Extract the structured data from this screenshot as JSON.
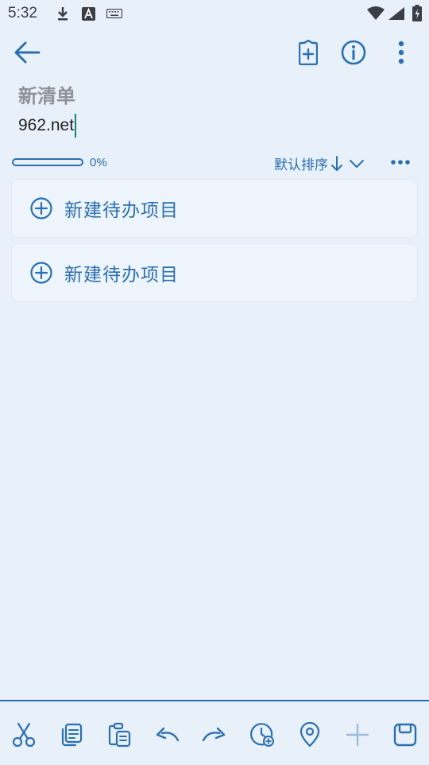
{
  "status_bar": {
    "time": "5:32"
  },
  "header": {
    "back_icon": "arrow-left-icon",
    "add_tag_icon": "tag-add-icon",
    "info_icon": "info-icon",
    "more_icon": "more-vertical-icon"
  },
  "list": {
    "title": "新清单",
    "title_input_value": "962.net",
    "progress_percent": 0,
    "progress_label": "0%",
    "sort_label": "默认排序",
    "items": [
      {
        "label": "新建待办项目"
      },
      {
        "label": "新建待办项目"
      }
    ]
  },
  "toolbar": {
    "icons": [
      "cut-icon",
      "copy-icon",
      "paste-icon",
      "undo-icon",
      "redo-icon",
      "add-reminder-icon",
      "location-icon",
      "add-icon",
      "save-icon"
    ]
  },
  "colors": {
    "accent": "#2a6fb0",
    "background": "#e8f0fa",
    "card": "#eef4fc",
    "caret": "#17867a"
  }
}
